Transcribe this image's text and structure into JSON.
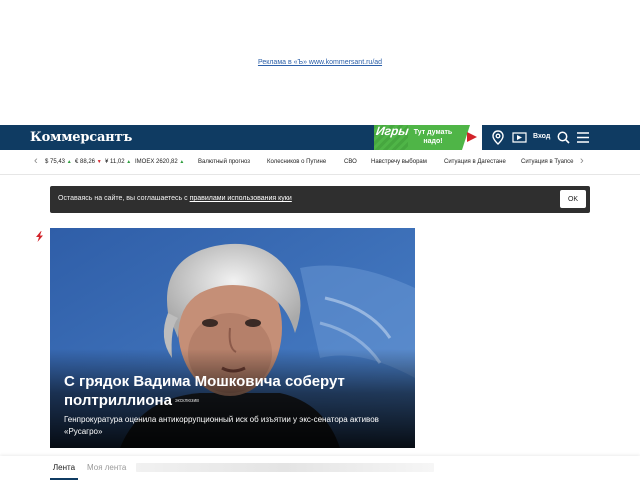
{
  "ad": {
    "link_text": "Реклама в «Ъ» www.kommersant.ru/ad"
  },
  "header": {
    "logo": "Коммерсантъ",
    "games_banner": {
      "big_text": "Игры",
      "text": "Тут думать надо!"
    },
    "login_label": "Вход",
    "icons": [
      "location-icon",
      "radio-icon",
      "search-icon",
      "menu-icon"
    ],
    "brand_color": "#0f3b62"
  },
  "ticker": {
    "quotes": [
      {
        "label": "$ 75,43",
        "trend": "up"
      },
      {
        "label": "€ 88,26",
        "trend": "down"
      },
      {
        "label": "¥ 11,02",
        "trend": "up"
      },
      {
        "label": "IMOEX 2620,82",
        "trend": "up"
      }
    ],
    "links": [
      "Валютный прогноз",
      "Колесников о Путине",
      "СВО",
      "Навстречу выборам",
      "Ситуация в Дагестане",
      "Ситуация в Туапсе"
    ]
  },
  "cookie": {
    "text": "Оставаясь на сайте, вы соглашаетесь с",
    "link": "правилами использования куки",
    "button": "OK"
  },
  "hero": {
    "title": "С грядок Вадима Мошковича соберут полтриллиона",
    "badge": "эксклюзив",
    "lead": "Генпрокуратура оценила антикоррупционный иск об изъятии у экс-сенатора активов «Русагро»"
  },
  "feed_tabs": {
    "feed": "Лента",
    "my_feed": "Моя лента"
  }
}
